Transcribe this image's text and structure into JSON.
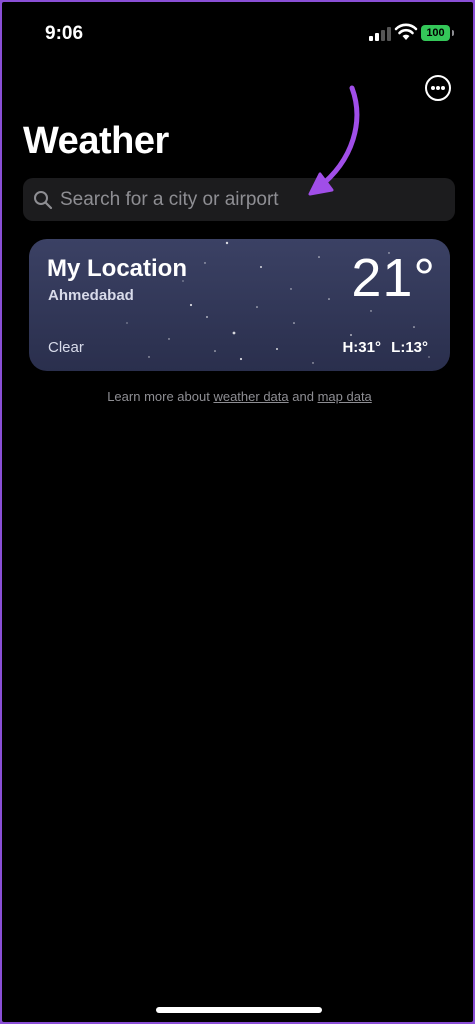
{
  "status_bar": {
    "time": "9:06",
    "battery": "100",
    "battery_color": "#34c759"
  },
  "header": {
    "title": "Weather",
    "more_icon": "ellipsis-circle-icon"
  },
  "search": {
    "placeholder": "Search for a city or airport",
    "icon": "search-icon"
  },
  "annotation": {
    "color": "#a04ee8"
  },
  "locations": [
    {
      "name": "My Location",
      "city": "Ahmedabad",
      "temperature": "21°",
      "condition": "Clear",
      "high": "H:31°",
      "low": "L:13°"
    }
  ],
  "footer": {
    "prefix": "Learn more about",
    "link1": "weather data",
    "middle": "and",
    "link2": "map data"
  }
}
